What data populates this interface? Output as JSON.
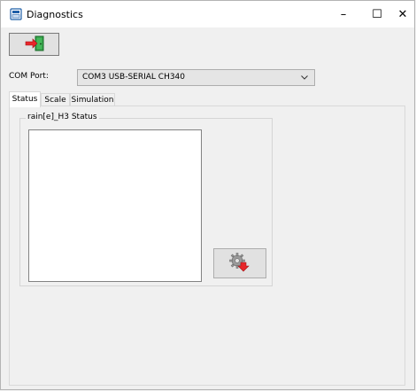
{
  "window": {
    "title": "Diagnostics",
    "minimize_glyph": "–",
    "maximize_glyph": "☐",
    "close_glyph": "✕"
  },
  "toolbar": {
    "exit_icon": "exit-door-arrow-icon"
  },
  "com_port": {
    "label": "COM Port:",
    "selected": "COM3  USB-SERIAL CH340"
  },
  "tabs": [
    {
      "label": "Status",
      "active": true
    },
    {
      "label": "Scale",
      "active": false
    },
    {
      "label": "Simulation",
      "active": false
    }
  ],
  "status_panel": {
    "group_title": "rain[e]_H3 Status",
    "status_text": "",
    "action_icon": "gear-download-icon"
  },
  "colors": {
    "exit_arrow": "#e8262a",
    "door": "#2f9e44",
    "gear": "#9a9a9a"
  }
}
